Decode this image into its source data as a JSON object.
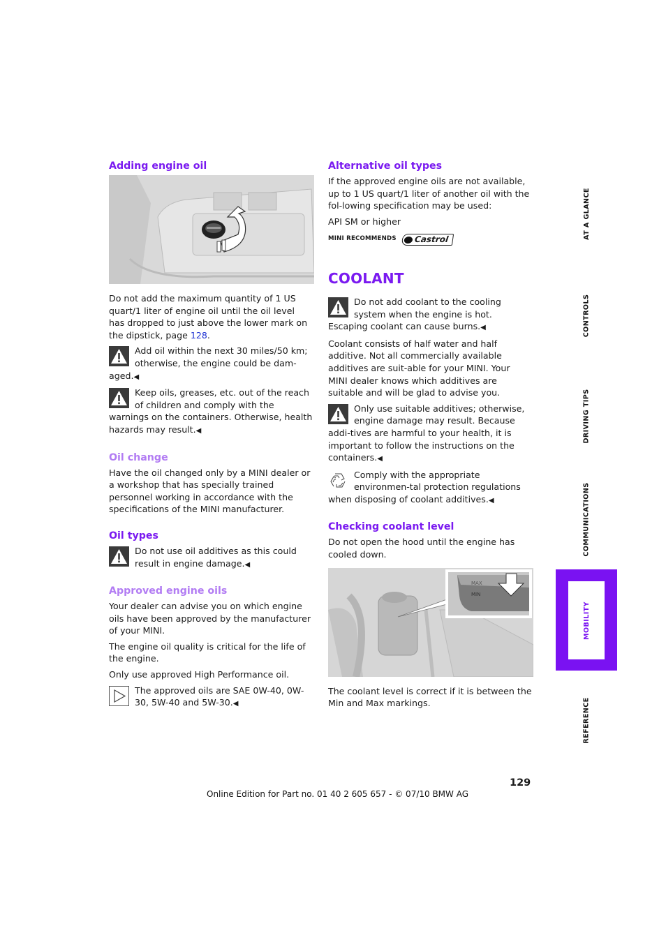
{
  "left": {
    "adding_oil": {
      "heading": "Adding engine oil",
      "image_alt": "Engine compartment with oil filler cap and twist arrow",
      "para": "Do not add the maximum quantity of 1 US quart/1 liter of engine oil until the oil level has dropped to just above the lower mark on the dipstick, page ",
      "page_link": "128",
      "para_end": ".",
      "warning1": "Add oil within the next 30 miles/50 km; otherwise, the engine could be dam-aged.",
      "warning2": "Keep oils, greases, etc. out of the reach of children and comply with the warnings on the containers. Otherwise, health hazards may result."
    },
    "oil_change": {
      "heading": "Oil change",
      "para": "Have the oil changed only by a MINI dealer or a workshop that has specially trained personnel working in accordance with the specifications of the MINI manufacturer."
    },
    "oil_types": {
      "heading": "Oil types",
      "warning": "Do not use oil additives as this could result in engine damage."
    },
    "approved_oils": {
      "heading": "Approved engine oils",
      "para1": "Your dealer can advise you on which engine oils have been approved by the manufacturer of your MINI.",
      "para2": "The engine oil quality is critical for the life of the engine.",
      "para3": "Only use approved High Performance oil.",
      "hint": "The approved oils are SAE 0W-40, 0W-30, 5W-40 and 5W-30."
    }
  },
  "right": {
    "alt_oil": {
      "heading": "Alternative oil types",
      "para": "If the approved engine oils are not available, up to 1 US quart/1 liter of another oil with the fol-lowing specification may be used:",
      "spec": "API SM or higher",
      "reco_label": "MINI RECOMMENDS",
      "brand": "Castrol"
    },
    "coolant": {
      "heading": "COOLANT",
      "warning1": "Do not add coolant to the cooling system when the engine is hot. Escaping coolant can cause burns.",
      "para": "Coolant consists of half water and half additive. Not all commercially available additives are suit-able for your MINI. Your MINI dealer knows which additives are suitable and will be glad to advise you.",
      "warning2": "Only use suitable additives; otherwise, engine damage may result. Because addi-tives are harmful to your health, it is important to follow the instructions on the containers.",
      "env_note": "Comply with the appropriate environmen-tal protection regulations when disposing of coolant additives."
    },
    "checking": {
      "heading": "Checking coolant level",
      "para": "Do not open the hood until the engine has cooled down.",
      "image_alt": "Coolant expansion tank with Min/Max markings",
      "para2": "The coolant level is correct if it is between the Min and Max markings."
    }
  },
  "end_mark": "◀",
  "tabs": [
    {
      "label": "AT A GLANCE",
      "active": false
    },
    {
      "label": "CONTROLS",
      "active": false
    },
    {
      "label": "DRIVING TIPS",
      "active": false
    },
    {
      "label": "COMMUNICATIONS",
      "active": false
    },
    {
      "label": "MOBILITY",
      "active": true
    },
    {
      "label": "REFERENCE",
      "active": false
    }
  ],
  "colors": {
    "accent": "#7a12f2",
    "accent_light": "#b27cf3",
    "link": "#1e32d2"
  },
  "page_number": "129",
  "footer": "Online Edition for Part no. 01 40 2 605 657 - © 07/10  BMW AG"
}
